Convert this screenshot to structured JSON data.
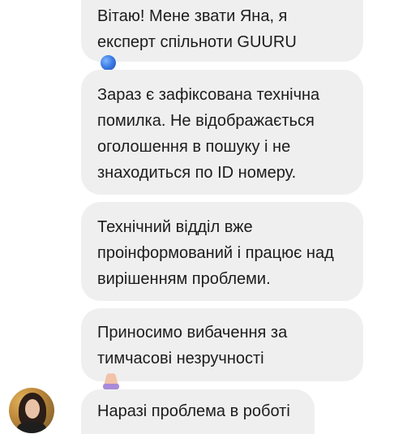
{
  "messages": [
    {
      "text": "Вітаю! Мене звати Яна, я\nексперт спільноти GUURU",
      "emoji": "globe-icon"
    },
    {
      "text": "Зараз є зафіксована технічна\nпомилка. Не відображається\nоголошення в пошуку і не\nзнаходиться по ID номеру."
    },
    {
      "text": "Технічний відділ вже\nпроінформований і працює над\nвирішенням проблеми."
    },
    {
      "text": "Приносимо вибачення за\nтимчасові незручності",
      "emoji": "folded-hands-icon"
    },
    {
      "text": "Наразі проблема в роботі"
    }
  ],
  "avatar": {
    "name": "agent-avatar"
  },
  "colors": {
    "bubble": "#efefef",
    "text": "#1c1c1c"
  }
}
